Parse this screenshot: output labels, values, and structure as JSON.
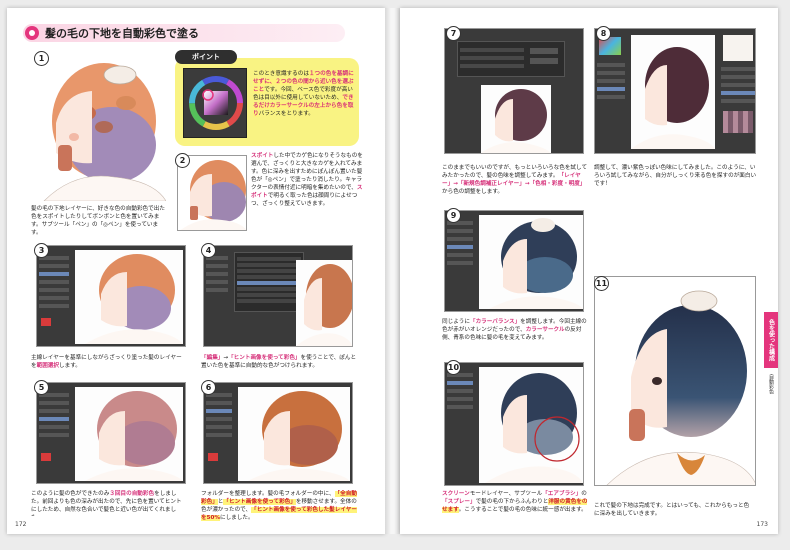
{
  "left_page": {
    "section_title": "髪の毛の下地を自動彩色で塗る",
    "page_number": "172",
    "steps": [
      "1",
      "2",
      "3",
      "4",
      "5",
      "6"
    ],
    "point_label": "ポイント",
    "point_text_1": "このとき意識するのは",
    "point_text_hl1": "１つの色を基調にせずに、２つの色の間から近い色を選ぶこと",
    "point_text_2": "です。",
    "point_text_3": "今回、ベース色で彩度が高い色は目以外に使用していないため、",
    "point_text_hl2": "できるだけカラーサークルの左上から色を取り",
    "point_text_4": "バランスをとります。",
    "step2_hl": "スポイト",
    "step2_text": "した中でカゲ色になりそうなものを選んで、ざっくりと大きなカゲを入れてみます。色に深みを出すためにぽんぽん置いた髪色が「◎ペン」で塗ったり消したり。キャラクターの表情付近に明暗を集めたいので、",
    "step2_hl2": "スポイト",
    "step2_text2": "で明るく取った色は顔周りによせつつ、ざっくり整えていきます。",
    "step1_text": "髪の毛の下地レイヤーに、好きな色の自動彩色で出た色をスポイトしたりしてボンボンと色を置いてみます。サブツール「ペン」の「◎ペン」を使っています。",
    "step3_text_a": "主線レイヤーを基準にしながらざっくり塗った髪のレイヤーを",
    "step3_hl": "範囲選択",
    "step3_text_b": "します。",
    "step4_hl1": "「編集」",
    "step4_arrow": "→",
    "step4_hl2": "「ヒント画像を使って彩色」",
    "step4_text": "を使うことで、ぽんと置いた色を基準に自動的な色がつけられます。",
    "step5_text_a": "このように髪の色ができたのみ",
    "step5_hl": "３回目の自動彩色",
    "step5_text_b": "をしました。前回よりも色の深みが出たので、先に色を置いてヒントにしたため、自然な色合いで髪色と近い色が出てくれました。",
    "step6_text_a": "フォルダーを整理します。",
    "step6_text_b": "髪の毛フォルダーの中に、",
    "step6_hl1": "「全自動彩色」",
    "step6_text_c": "と",
    "step6_hl2": "「ヒント画像を使って彩色」",
    "step6_text_d": "を移動させます。全体の色が濃かったので、",
    "step6_hl3": "「ヒント画像を使って彩色した髪レイヤーを50%",
    "step6_text_e": "にしました。"
  },
  "right_page": {
    "page_number": "173",
    "steps": [
      "7",
      "8",
      "9",
      "10",
      "11"
    ],
    "step7_text": "このままでもいいのですが、もっといろいろな色を試してみたかったので、髪の色味を調整してみます。",
    "step7_hl": "「レイヤー」→「新規色調補正レイヤー」→「色相・彩度・明度」",
    "step7_text_b": "から色の調整をします。",
    "step8_text": "調整して、濃い紫色っぽい色味にしてみました。このように、いろいろ試してみながら、自分がしっくり来る色を探すのが面白いです！",
    "step9_text_a": "同じように",
    "step9_hl": "「カラーバランス」",
    "step9_text_b": "を調整します。今回主線の色が赤がいオレンジだったので、",
    "step9_hl2": "カラーサークル",
    "step9_text_c": "の反対側、青系の色味に髪の毛を変えてみます。",
    "step10_hl1": "スクリーン",
    "step10_text_a": "モードレイヤー、サブツール",
    "step10_hl2": "「エアブラシ」",
    "step10_text_b": "の",
    "step10_hl3": "「スプレー」",
    "step10_text_c": "で髪の毛の下からふんわりと",
    "step10_hl4": "洋服の黄色をのせます",
    "step10_text_d": "。こうすることで髪の毛の色味に統一感が出ます。",
    "step11_text": "これで髪の下地は完成です。とはいっても、これからもっと色に深みを出していきます。",
    "side_tab": "色を使った構成",
    "side_sub": "自動彩色"
  },
  "colors": {
    "accent": "#e4357d",
    "highlight": "#fff37a",
    "point_box": "#f9f383",
    "ui_dark": "#3a3a3a"
  }
}
